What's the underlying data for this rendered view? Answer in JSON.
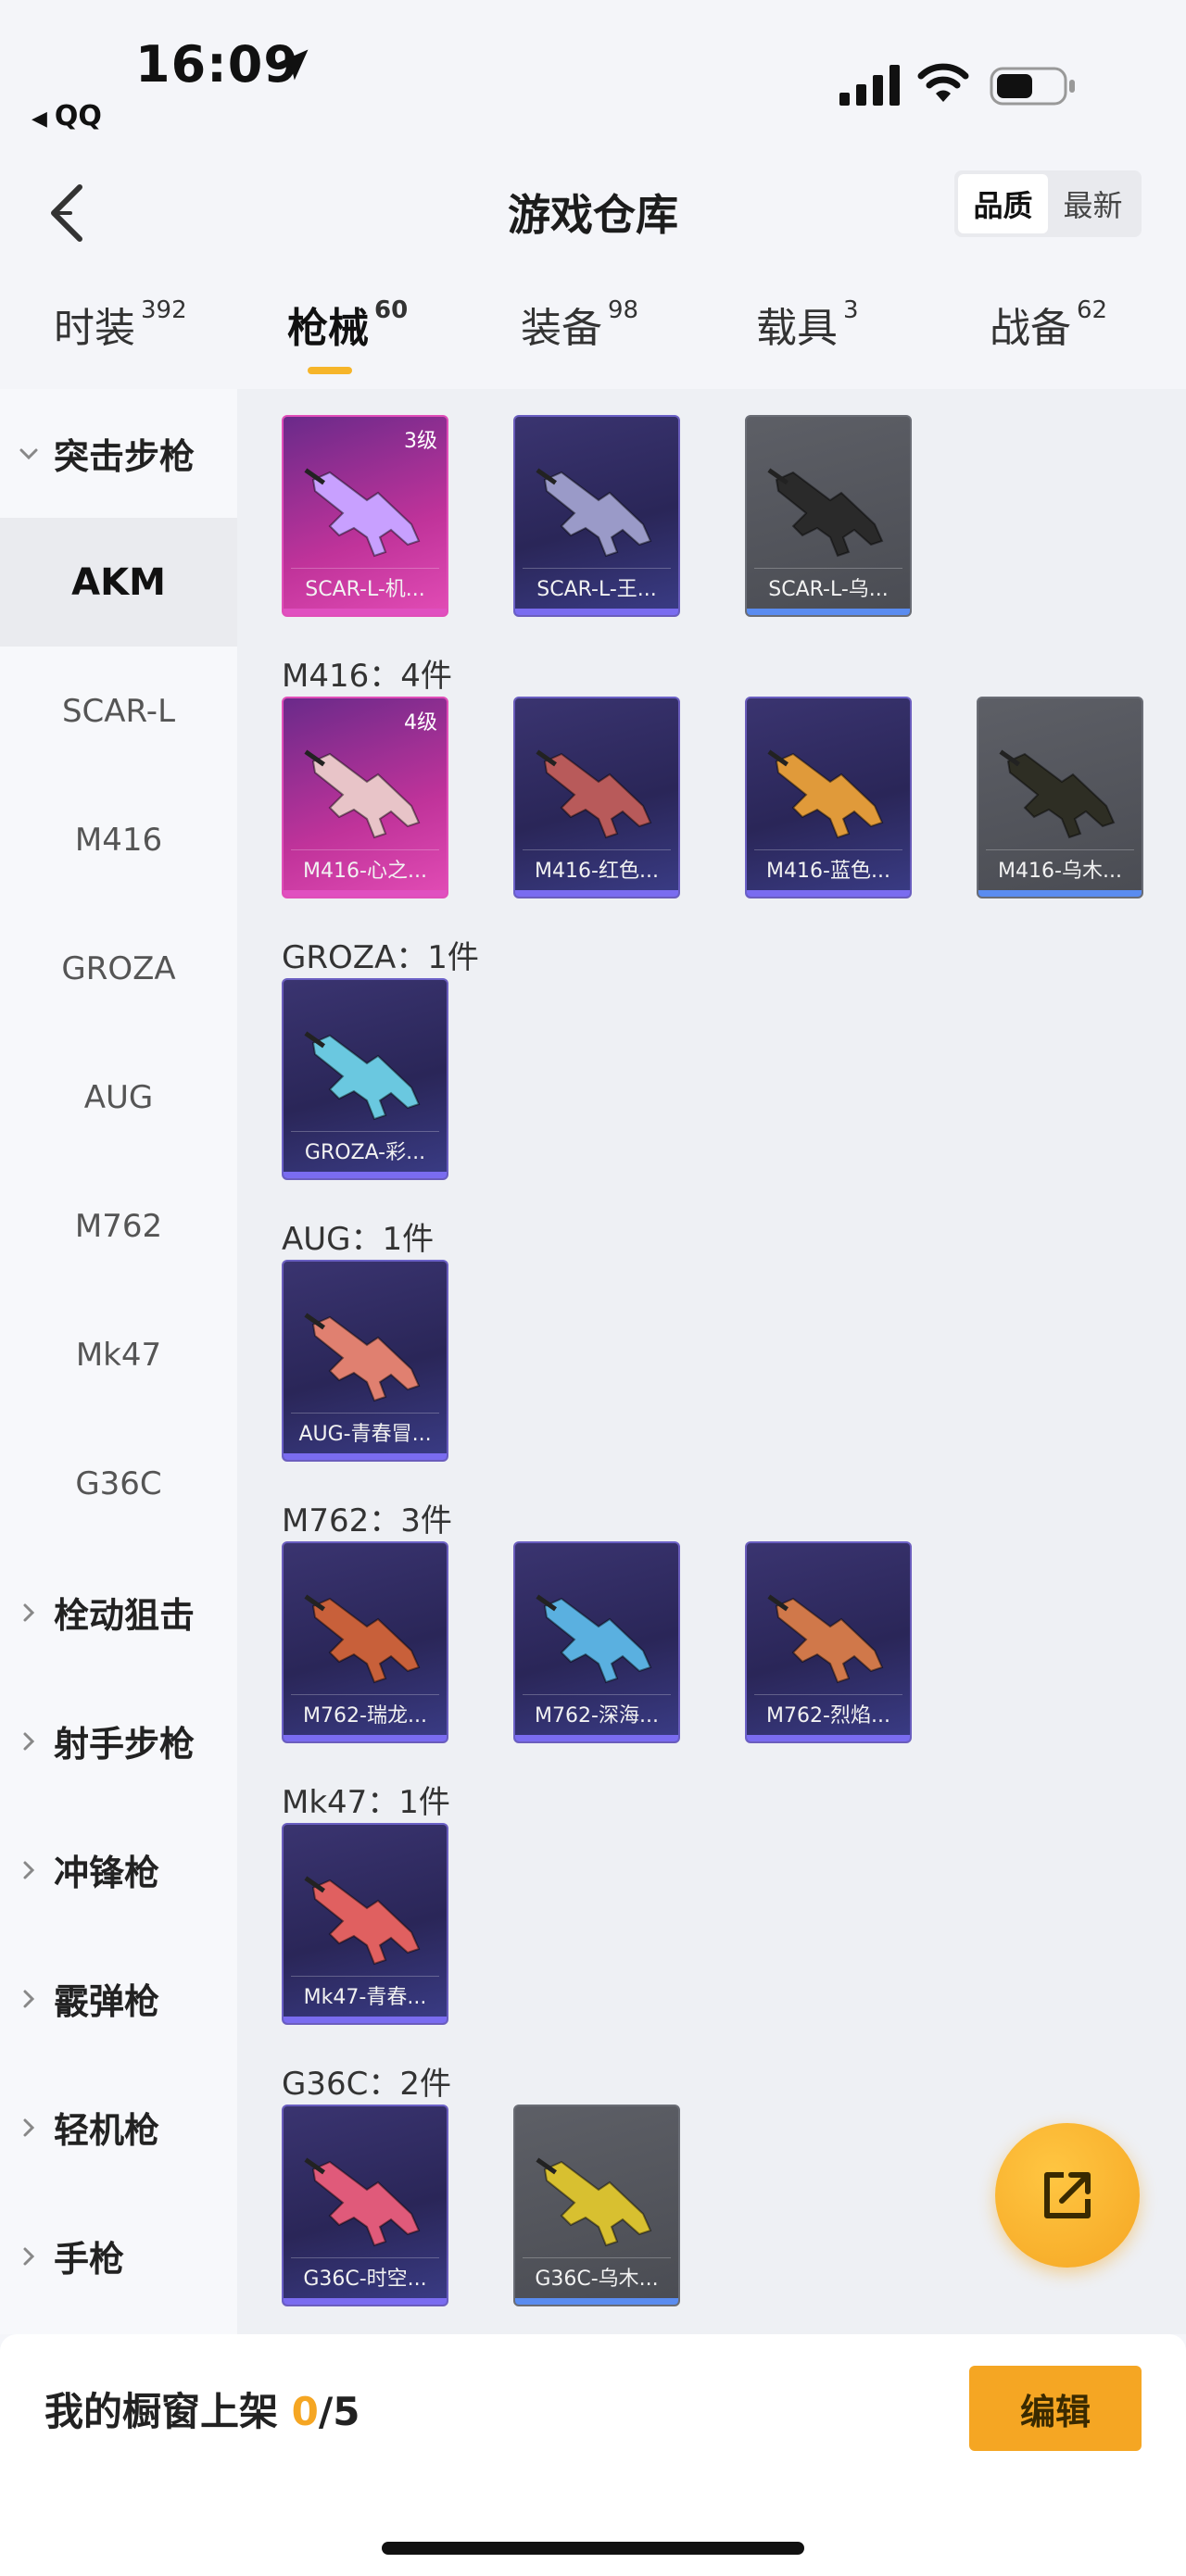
{
  "status": {
    "time": "16:09",
    "back_app": "QQ"
  },
  "header": {
    "title": "游戏仓库",
    "sort_options": [
      "品质",
      "最新"
    ],
    "sort_active": 0
  },
  "tabs": [
    {
      "label": "时装",
      "count": "392"
    },
    {
      "label": "枪械",
      "count": "60"
    },
    {
      "label": "装备",
      "count": "98"
    },
    {
      "label": "载具",
      "count": "3"
    },
    {
      "label": "战备",
      "count": "62"
    }
  ],
  "active_tab": 1,
  "sidebar": [
    {
      "label": "突击步枪",
      "type": "group",
      "expanded": true
    },
    {
      "label": "AKM",
      "type": "sub",
      "active": true
    },
    {
      "label": "SCAR-L",
      "type": "sub"
    },
    {
      "label": "M416",
      "type": "sub"
    },
    {
      "label": "GROZA",
      "type": "sub"
    },
    {
      "label": "AUG",
      "type": "sub"
    },
    {
      "label": "M762",
      "type": "sub"
    },
    {
      "label": "Mk47",
      "type": "sub"
    },
    {
      "label": "G36C",
      "type": "sub"
    },
    {
      "label": "栓动狙击",
      "type": "group"
    },
    {
      "label": "射手步枪",
      "type": "group"
    },
    {
      "label": "冲锋枪",
      "type": "group"
    },
    {
      "label": "霰弹枪",
      "type": "group"
    },
    {
      "label": "轻机枪",
      "type": "group"
    },
    {
      "label": "手枪",
      "type": "group"
    }
  ],
  "groups": [
    {
      "title": "",
      "items": [
        {
          "name": "SCAR-L-机...",
          "tier": "gold",
          "level": "3级",
          "color": "#c8a0ff"
        },
        {
          "name": "SCAR-L-王...",
          "tier": "purple",
          "color": "#9a9ac8"
        },
        {
          "name": "SCAR-L-乌...",
          "tier": "gray",
          "color": "#2a2a2a"
        }
      ]
    },
    {
      "title": "M416：4件",
      "items": [
        {
          "name": "M416-心之...",
          "tier": "gold",
          "level": "4级",
          "color": "#e8c4c8"
        },
        {
          "name": "M416-红色...",
          "tier": "purple",
          "color": "#b85a5a"
        },
        {
          "name": "M416-蓝色...",
          "tier": "purple",
          "color": "#e09a3a"
        },
        {
          "name": "M416-乌木...",
          "tier": "gray",
          "color": "#2e2e24"
        }
      ]
    },
    {
      "title": "GROZA：1件",
      "items": [
        {
          "name": "GROZA-彩...",
          "tier": "purple",
          "color": "#6ac8e0"
        }
      ]
    },
    {
      "title": "AUG：1件",
      "items": [
        {
          "name": "AUG-青春冒...",
          "tier": "purple",
          "color": "#e08070"
        }
      ]
    },
    {
      "title": "M762：3件",
      "items": [
        {
          "name": "M762-瑞龙...",
          "tier": "purple",
          "color": "#c8603a"
        },
        {
          "name": "M762-深海...",
          "tier": "purple",
          "color": "#5ab0e0"
        },
        {
          "name": "M762-烈焰...",
          "tier": "purple",
          "color": "#d0784a"
        }
      ]
    },
    {
      "title": "Mk47：1件",
      "items": [
        {
          "name": "Mk47-青春...",
          "tier": "purple",
          "color": "#e06060"
        }
      ]
    },
    {
      "title": "G36C：2件",
      "items": [
        {
          "name": "G36C-时空...",
          "tier": "purple",
          "color": "#e05a7a"
        },
        {
          "name": "G36C-乌木...",
          "tier": "gray",
          "color": "#d8c030"
        }
      ]
    }
  ],
  "footer": {
    "label": "我的橱窗上架",
    "current": "0",
    "total": "/5",
    "edit": "编辑"
  }
}
